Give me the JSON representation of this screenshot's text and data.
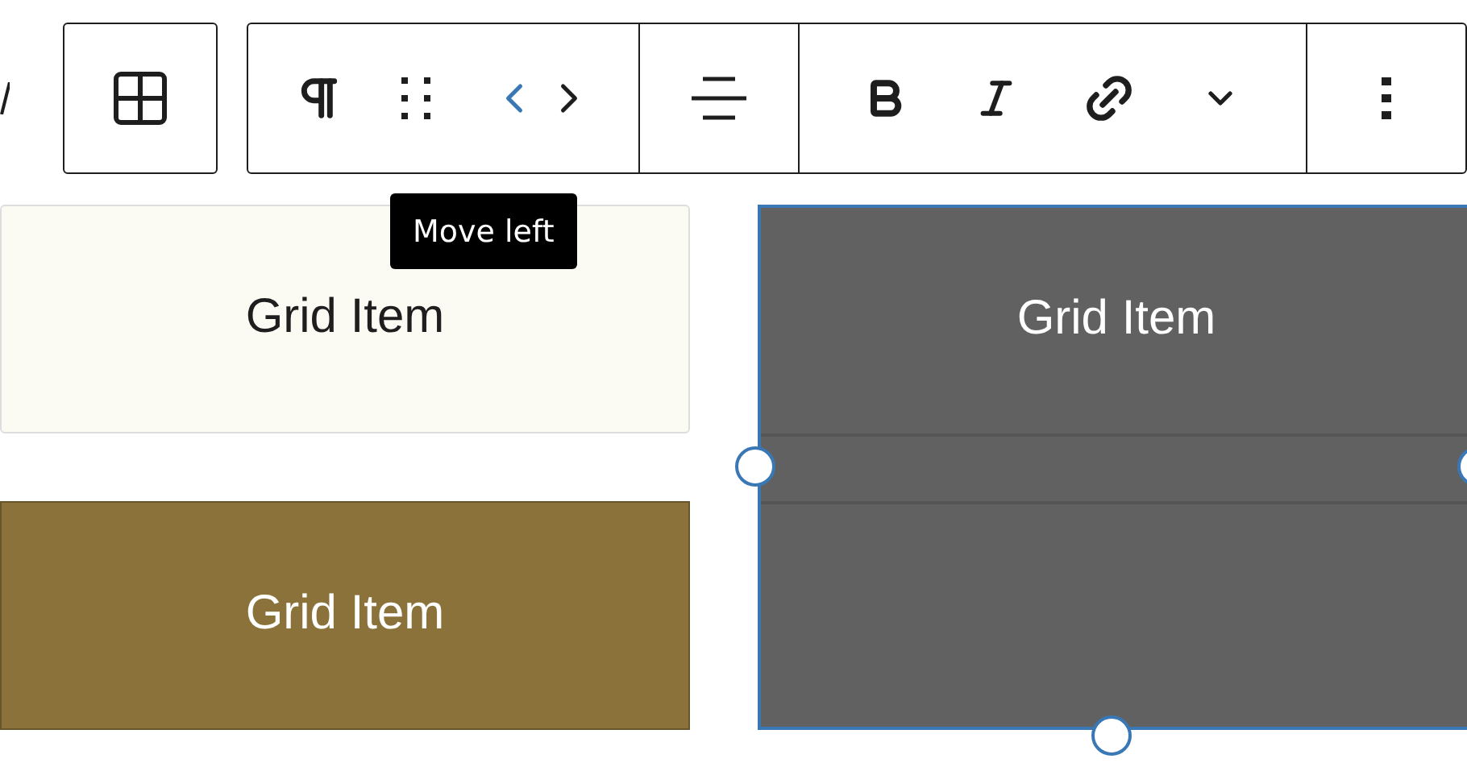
{
  "toolbar": {
    "movers": [
      {
        "kind": "left",
        "highlighted": true
      },
      {
        "kind": "right",
        "highlighted": false
      }
    ]
  },
  "tooltip": {
    "text": "Move left"
  },
  "grid_items": [
    {
      "label": "Grid Item",
      "color": "#fbfaf3",
      "selected": false
    },
    {
      "label": "Grid Item",
      "color": "#8a723a",
      "selected": false
    },
    {
      "label": "Grid Item",
      "color": "#616161",
      "selected": true
    }
  ]
}
